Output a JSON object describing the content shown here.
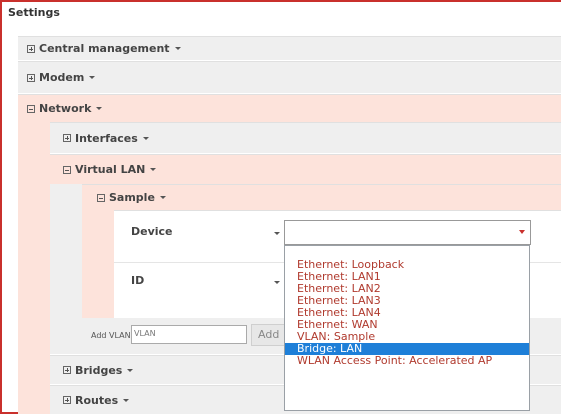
{
  "settings": {
    "title": "Settings"
  },
  "sections": {
    "central_management": "Central management",
    "modem": "Modem",
    "network": "Network",
    "interfaces": "Interfaces",
    "virtual_lan": "Virtual LAN",
    "sample": "Sample",
    "bridges": "Bridges",
    "routes": "Routes"
  },
  "fields": {
    "device_label": "Device",
    "id_label": "ID",
    "device_value": ""
  },
  "add_vlan": {
    "label": "Add VLAN",
    "placeholder": "VLAN",
    "button_label": "Add"
  },
  "dropdown": {
    "options": [
      "Ethernet: Loopback",
      "Ethernet: LAN1",
      "Ethernet: LAN2",
      "Ethernet: LAN3",
      "Ethernet: LAN4",
      "Ethernet: WAN",
      "VLAN: Sample",
      "Bridge: LAN",
      "WLAN Access Point: Accelerated AP"
    ],
    "selected_index": 7
  },
  "colors": {
    "accent_red": "#c9302c",
    "expanded_bg": "#fde3db",
    "collapsed_bg": "#efefef",
    "selected_option": "#1e7fd8",
    "option_text": "#b03a2e"
  }
}
